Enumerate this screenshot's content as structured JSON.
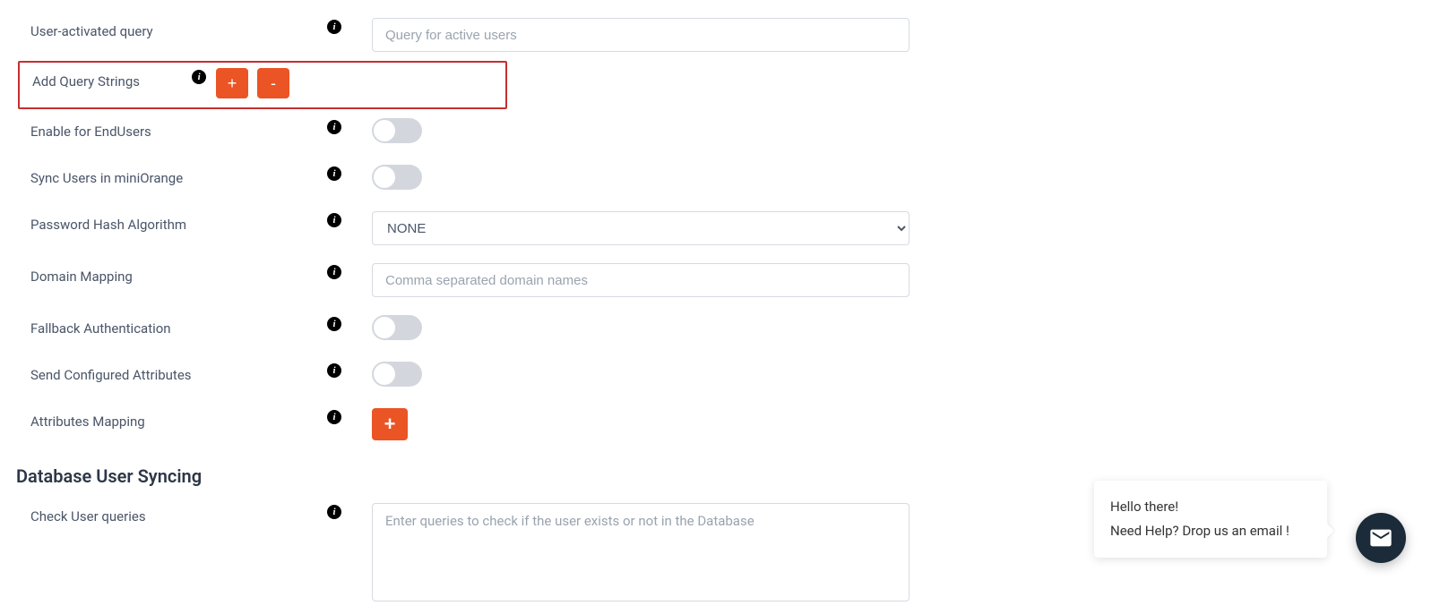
{
  "rows": {
    "user_activated_query": {
      "label": "User-activated query",
      "placeholder": "Query for active users",
      "value": ""
    },
    "add_query_strings": {
      "label": "Add Query Strings",
      "plus": "+",
      "minus": "-"
    },
    "enable_endusers": {
      "label": "Enable for EndUsers",
      "on": false
    },
    "sync_users": {
      "label": "Sync Users in miniOrange",
      "on": false
    },
    "password_hash": {
      "label": "Password Hash Algorithm",
      "selected": "NONE"
    },
    "domain_mapping": {
      "label": "Domain Mapping",
      "placeholder": "Comma separated domain names",
      "value": ""
    },
    "fallback_auth": {
      "label": "Fallback Authentication",
      "on": false
    },
    "send_attrs": {
      "label": "Send Configured Attributes",
      "on": false
    },
    "attr_mapping": {
      "label": "Attributes Mapping",
      "plus": "+"
    },
    "check_user": {
      "label": "Check User queries",
      "placeholder": "Enter queries to check if the user exists or not in the Database",
      "value": ""
    }
  },
  "section": {
    "db_sync": "Database User Syncing"
  },
  "info_glyph": "i",
  "chat": {
    "line1": "Hello there!",
    "line2": "Need Help? Drop us an email !"
  }
}
